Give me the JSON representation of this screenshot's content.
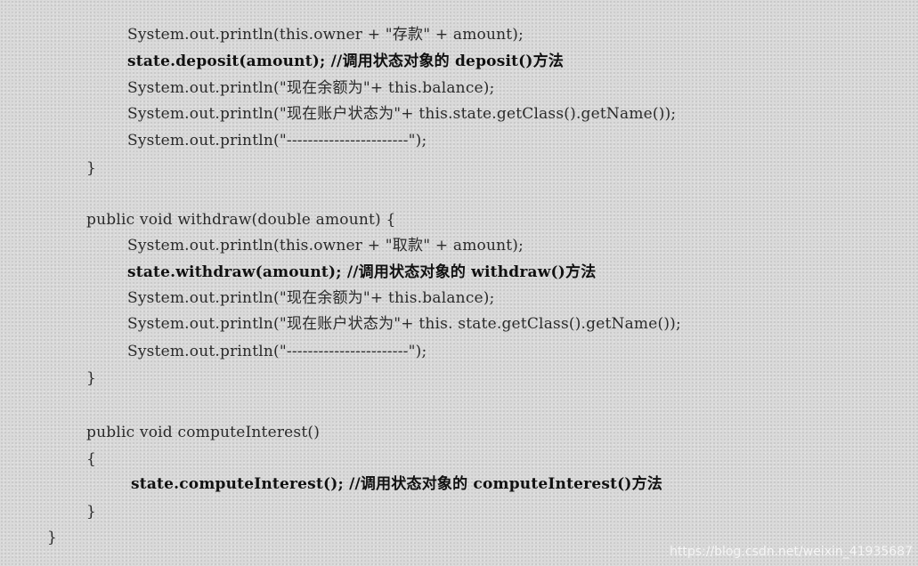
{
  "code": {
    "lines": [
      "System.out.println(this.owner + \"存款\" + amount);",
      "state.deposit(amount); //调用状态对象的 deposit()方法",
      "System.out.println(\"现在余额为\"+ this.balance);",
      "System.out.println(\"现在账户状态为\"+ this.state.getClass().getName());",
      "System.out.println(\"-----------------------\");",
      "}",
      "public void withdraw(double amount) {",
      "System.out.println(this.owner + \"取款\" + amount);",
      "state.withdraw(amount); //调用状态对象的 withdraw()方法",
      "System.out.println(\"现在余额为\"+ this.balance);",
      "System.out.println(\"现在账户状态为\"+ this. state.getClass().getName());",
      "System.out.println(\"-----------------------\");",
      "}",
      "public void computeInterest()",
      "{",
      "state.computeInterest(); //调用状态对象的 computeInterest()方法",
      "}",
      "}"
    ]
  },
  "watermark": "https://blog.csdn.net/weixin_41935687"
}
